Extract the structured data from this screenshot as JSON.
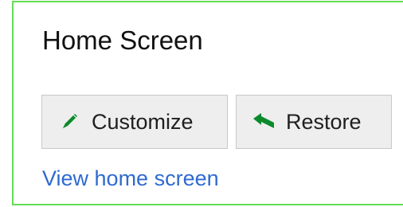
{
  "section": {
    "title": "Home Screen"
  },
  "buttons": {
    "customize_label": "Customize",
    "customize_icon": "pencil-icon",
    "restore_label": "Restore",
    "restore_icon": "undo-arrow-icon"
  },
  "link": {
    "view_home_screen": "View home screen"
  },
  "colors": {
    "panel_border": "#66dd55",
    "icon_green": "#0a8a2a",
    "link_blue": "#2f6ad0",
    "button_bg": "#eeeeee"
  }
}
